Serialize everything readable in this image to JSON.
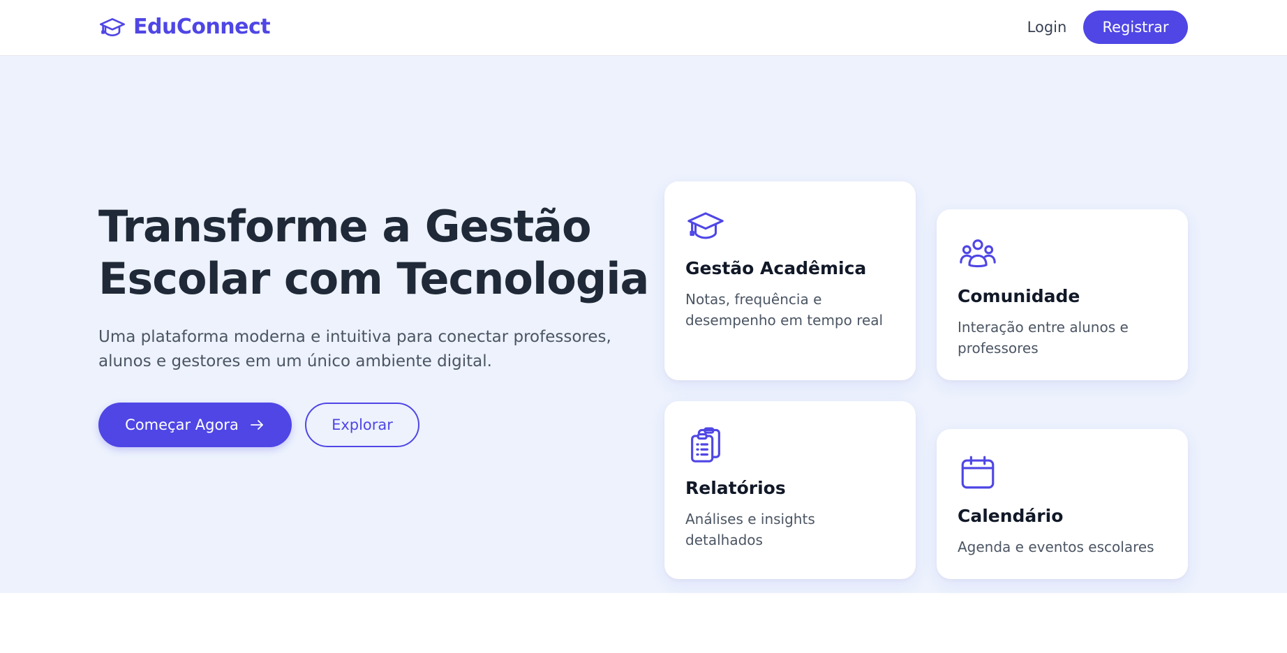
{
  "header": {
    "brand_name": "EduConnect",
    "brand_icon": "graduation-cap-icon",
    "login_label": "Login",
    "register_label": "Registrar"
  },
  "hero": {
    "title_lines": [
      "Transforme a Gestão",
      "Escolar com Tecnologia"
    ],
    "subtitle_lines": [
      "Uma plataforma moderna e intuitiva para conectar professores,",
      "alunos e gestores em um único ambiente digital."
    ],
    "primary_button_label": "Começar Agora",
    "primary_button_icon": "arrow-right-icon",
    "secondary_button_label": "Explorar"
  },
  "features": [
    {
      "icon": "graduation-cap-icon",
      "title": "Gestão Acadêmica",
      "description_lines": [
        "Notas, frequência e",
        "desempenho em tempo real"
      ]
    },
    {
      "icon": "users-icon",
      "title": "Comunidade",
      "description_lines": [
        "Interação entre alunos e",
        "professores"
      ]
    },
    {
      "icon": "clipboard-list-icon",
      "title": "Relatórios",
      "description_lines": [
        "Análises e insights",
        "detalhados"
      ]
    },
    {
      "icon": "calendar-icon",
      "title": "Calendário",
      "description_lines": [
        "Agenda e eventos escolares"
      ]
    }
  ],
  "colors": {
    "accent": "#4f46e5",
    "hero_background": "#edf2fd",
    "heading_text": "#1f2937",
    "body_text": "#4b5563",
    "card_background": "#ffffff"
  }
}
